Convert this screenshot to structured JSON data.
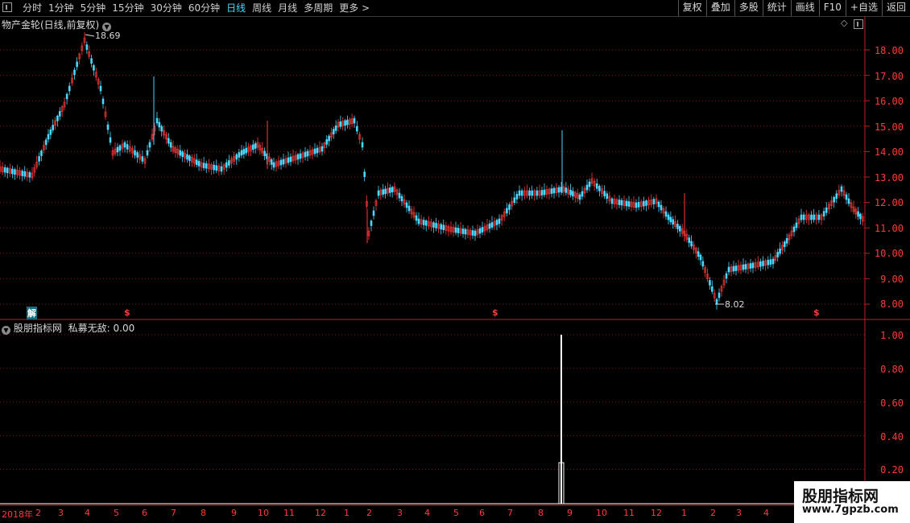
{
  "toolbar": {
    "periods": [
      "分时",
      "1分钟",
      "5分钟",
      "15分钟",
      "30分钟",
      "60分钟",
      "日线",
      "周线",
      "月线",
      "多周期",
      "更多 >"
    ],
    "active_period": "日线",
    "actions": [
      "复权",
      "叠加",
      "多股",
      "统计",
      "画线",
      "F10",
      "+自选",
      "返回"
    ]
  },
  "main_panel": {
    "title": "物产金轮(日线,前复权)",
    "high_label": "18.69",
    "low_label": "8.02",
    "markers": {
      "jie": "解",
      "s1": "$",
      "s2": "$",
      "s3": "$"
    },
    "y_axis": [
      "18.00",
      "17.00",
      "16.00",
      "15.00",
      "14.00",
      "13.00",
      "12.00",
      "11.00",
      "10.00",
      "9.00",
      "8.00"
    ]
  },
  "indicator_panel": {
    "title": "股朋指标网",
    "name": "私募无敌:",
    "value": "0.00",
    "y_axis": [
      "1.00",
      "0.80",
      "0.60",
      "0.40",
      "0.20"
    ]
  },
  "time_axis": [
    "2018年",
    "2",
    "3",
    "4",
    "5",
    "6",
    "7",
    "8",
    "9",
    "10",
    "11",
    "12",
    "1",
    "2",
    "3",
    "4",
    "5",
    "6",
    "7",
    "8",
    "9",
    "10",
    "11",
    "12",
    "1",
    "2",
    "3",
    "4"
  ],
  "watermark": {
    "line1": "股朋指标网",
    "line2": "www.7gpzb.com"
  },
  "colors": {
    "up": "#ff3b3b",
    "down": "#4ad8ff",
    "grid": "#8b1a1a",
    "signal": "#ffffff"
  }
}
